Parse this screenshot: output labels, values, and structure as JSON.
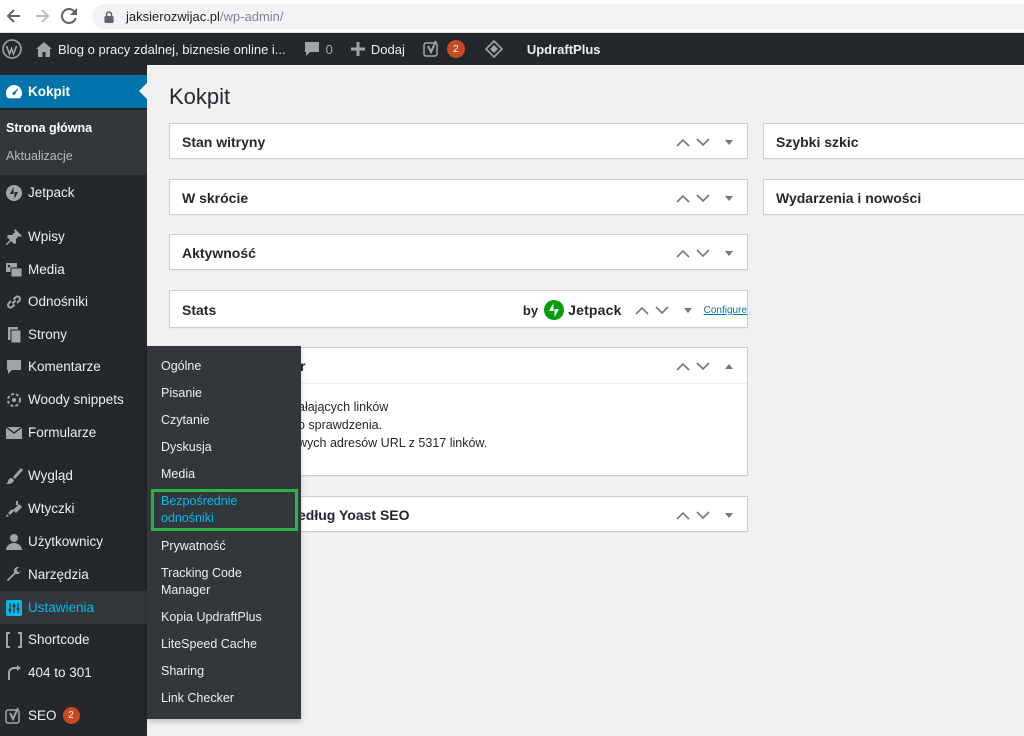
{
  "browser": {
    "url_host": "jaksierozwijac.pl",
    "url_path": "/wp-admin/"
  },
  "adminbar": {
    "site_name": "Blog o pracy zdalnej, biznesie online i...",
    "comments_count": "0",
    "new_label": "Dodaj",
    "yoast_count": "2",
    "updraft_label": "UpdraftPlus"
  },
  "sidebar": {
    "kokpit": "Kokpit",
    "sub_home": "Strona główna",
    "sub_updates": "Aktualizacje",
    "jetpack": "Jetpack",
    "wpisy": "Wpisy",
    "media": "Media",
    "odnosniki": "Odnośniki",
    "strony": "Strony",
    "komentarze": "Komentarze",
    "woody": "Woody snippets",
    "formularze": "Formularze",
    "wyglad": "Wygląd",
    "wtyczki": "Wtyczki",
    "uzytkownicy": "Użytkownicy",
    "narzedzia": "Narzędzia",
    "ustawienia": "Ustawienia",
    "shortcode": "Shortcode",
    "redirect": "404 to 301",
    "seo": "SEO",
    "seo_count": "2"
  },
  "main": {
    "title": "Kokpit",
    "boxes": {
      "stan": "Stan witryny",
      "skrocie": "W skrócie",
      "aktywnosc": "Aktywność",
      "stats": "Stats",
      "stats_by": "by",
      "stats_jetpack": "Jetpack",
      "stats_configure": "Configure",
      "broken_title_tail": "r",
      "broken_line1": "ałających linków",
      "broken_line2": "o sprawdzenia.",
      "broken_line3": "wych adresów URL z 5317 linków.",
      "yoast_tail": "edług Yoast SEO",
      "szkic": "Szybki szkic",
      "wydarzenia": "Wydarzenia i nowości"
    }
  },
  "flyout": {
    "items": [
      "Ogólne",
      "Pisanie",
      "Czytanie",
      "Dyskusja",
      "Media",
      "Bezpośrednie odnośniki",
      "Prywatność",
      "Tracking Code Manager",
      "Kopia UpdraftPlus",
      "LiteSpeed Cache",
      "Sharing",
      "Link Checker"
    ]
  },
  "colors": {
    "admin_dark": "#23282d",
    "admin_blue": "#0073aa",
    "highlight_cyan": "#00b9eb",
    "badge_orange": "#ca4a1f",
    "highlight_green": "#2eb34a"
  }
}
